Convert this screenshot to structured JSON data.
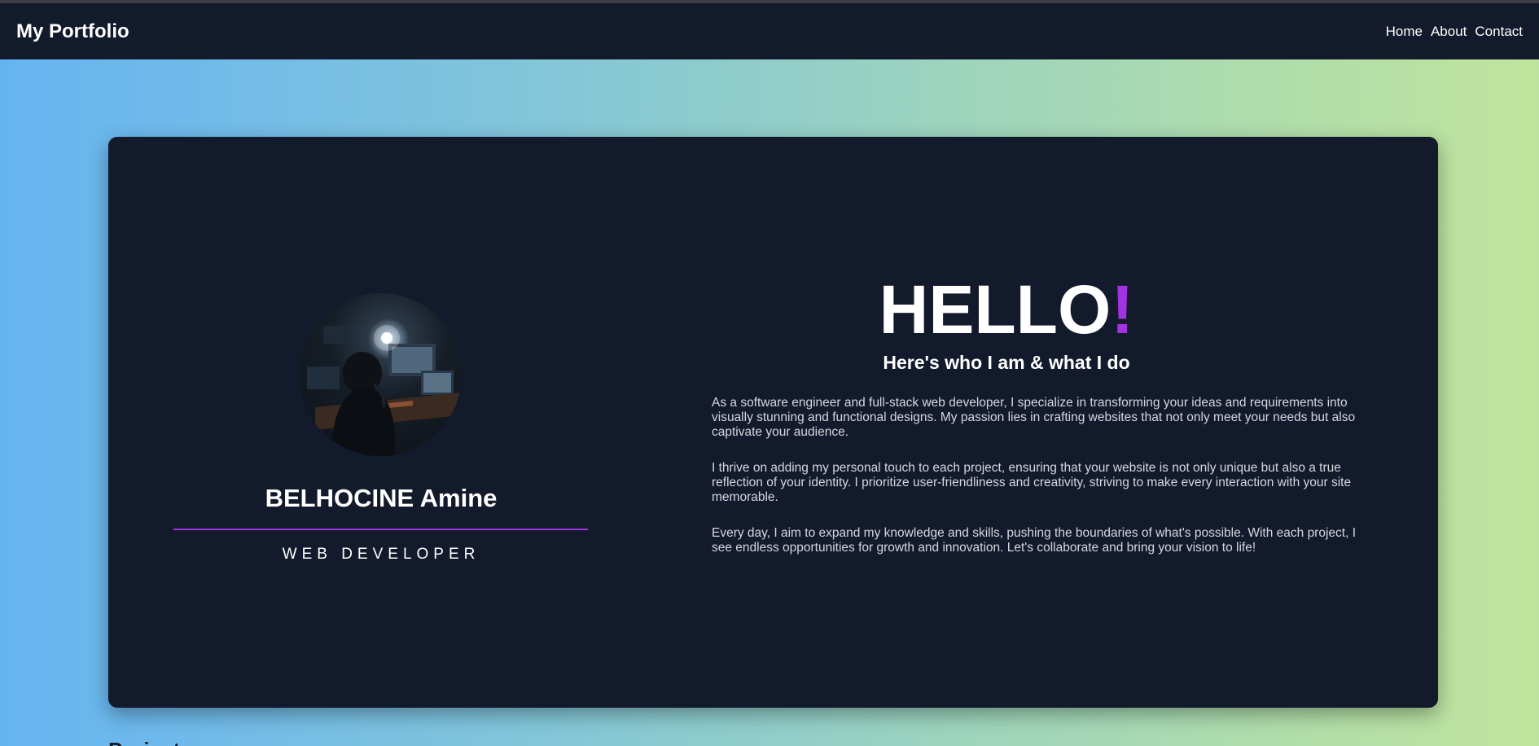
{
  "navbar": {
    "brand": "My Portfolio",
    "links": [
      "Home",
      "About",
      "Contact"
    ]
  },
  "profile": {
    "name": "BELHOCINE Amine",
    "role": "WEB DEVELOPER",
    "avatar_icon": "hacker-at-desk-photo"
  },
  "intro": {
    "greeting": "HELLO",
    "greeting_mark": "!",
    "subtitle": "Here's who I am & what I do",
    "paragraphs": [
      "As a software engineer and full-stack web developer, I specialize in transforming your ideas and requirements into visually stunning and functional designs. My passion lies in crafting websites that not only meet your needs but also captivate your audience.",
      "I thrive on adding my personal touch to each project, ensuring that your website is not only unique but also a true reflection of your identity. I prioritize user-friendliness and creativity, striving to make every interaction with your site memorable.",
      "Every day, I aim to expand my knowledge and skills, pushing the boundaries of what's possible. With each project, I see endless opportunities for growth and innovation. Let's collaborate and bring your vision to life!"
    ]
  },
  "projects": {
    "heading": "Projects"
  },
  "colors": {
    "navbar_bg": "#131a2c",
    "card_bg": "#131a2c",
    "accent": "#a233e0",
    "gradient_start": "#65b4f2",
    "gradient_end": "#c0e49c"
  }
}
